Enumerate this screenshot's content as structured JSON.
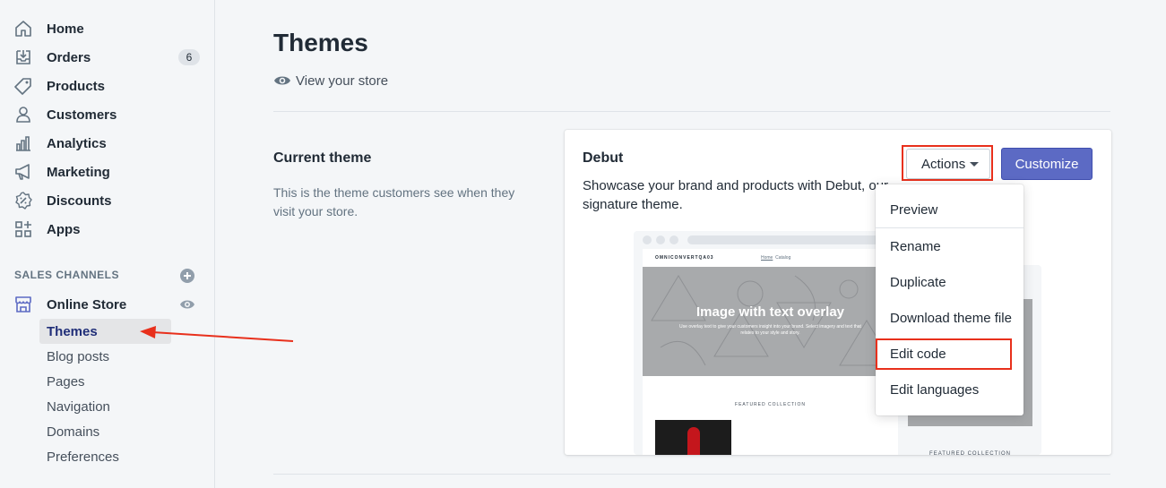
{
  "sidebar": {
    "items": [
      {
        "label": "Home",
        "icon": "home-icon"
      },
      {
        "label": "Orders",
        "icon": "orders-icon",
        "badge": "6"
      },
      {
        "label": "Products",
        "icon": "tag-icon"
      },
      {
        "label": "Customers",
        "icon": "person-icon"
      },
      {
        "label": "Analytics",
        "icon": "bar-chart-icon"
      },
      {
        "label": "Marketing",
        "icon": "megaphone-icon"
      },
      {
        "label": "Discounts",
        "icon": "discount-icon"
      },
      {
        "label": "Apps",
        "icon": "apps-icon"
      }
    ],
    "sales_channels_title": "SALES CHANNELS",
    "online_store": {
      "label": "Online Store",
      "icon": "store-icon"
    },
    "sub_items": [
      "Themes",
      "Blog posts",
      "Pages",
      "Navigation",
      "Domains",
      "Preferences"
    ]
  },
  "main": {
    "title": "Themes",
    "view_store": "View your store",
    "current_theme": {
      "title": "Current theme",
      "description": "This is the theme customers see when they visit your store."
    },
    "card": {
      "theme_name": "Debut",
      "description": "Showcase your brand and products with Debut, our signature theme.",
      "actions_label": "Actions",
      "customize_label": "Customize"
    },
    "preview": {
      "brand": "OMNICONVERTQA03",
      "nav_home": "Home",
      "nav_catalog": "Catalog",
      "hero_title": "Image with text overlay",
      "hero_sub": "Use overlay text to give your customers insight into your brand. Select imagery and text that relates to your style and story.",
      "featured": "FEATURED COLLECTION"
    },
    "actions_menu": [
      "Preview",
      "Rename",
      "Duplicate",
      "Download theme file",
      "Edit code",
      "Edit languages"
    ]
  },
  "colors": {
    "accent": "#5c6ac4",
    "highlight": "#e8301c",
    "active_text": "#202e78"
  }
}
